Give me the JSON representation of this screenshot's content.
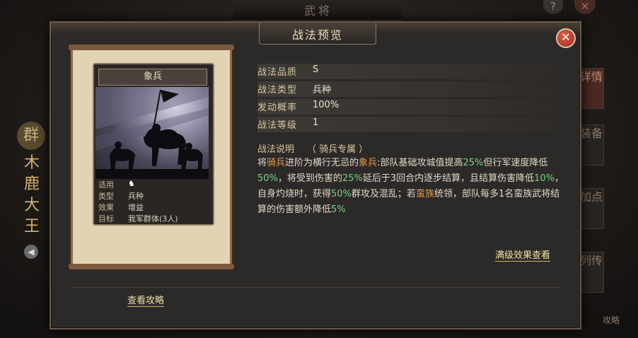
{
  "background": {
    "title": "武将",
    "help": "?",
    "close": "✕",
    "emblem": "群",
    "hero_name": "木鹿大王",
    "tabs": [
      "详情",
      "装备",
      "加点",
      "列传"
    ],
    "attack_text": "攻略"
  },
  "dialog": {
    "title": "战法预览",
    "close_glyph": "✕"
  },
  "card": {
    "name": "象兵",
    "rows": [
      {
        "label": "适用",
        "value": ""
      },
      {
        "label": "类型",
        "value": "兵种"
      },
      {
        "label": "效果",
        "value": "增益"
      },
      {
        "label": "目标",
        "value": "我军群体(3人)"
      }
    ],
    "applies_icon": "horse-icon"
  },
  "attributes": [
    {
      "label": "战法品质",
      "value": "S"
    },
    {
      "label": "战法类型",
      "value": "兵种"
    },
    {
      "label": "发动概率",
      "value": "100%"
    },
    {
      "label": "战法等级",
      "value": "1"
    }
  ],
  "description": {
    "heading": "战法说明",
    "tag": "（ 骑兵专属 ）",
    "segments": [
      {
        "text": "将",
        "style": ""
      },
      {
        "text": "骑兵",
        "style": "orange"
      },
      {
        "text": "进阶为横行无忌的",
        "style": ""
      },
      {
        "text": "象兵",
        "style": "orange"
      },
      {
        "text": ":部队基础攻城值提高",
        "style": ""
      },
      {
        "text": "25%",
        "style": "green"
      },
      {
        "text": "但行军速度降低",
        "style": ""
      },
      {
        "text": "50%",
        "style": "green"
      },
      {
        "text": "，将受到伤害的",
        "style": ""
      },
      {
        "text": "25%",
        "style": "green"
      },
      {
        "text": "延后于3回合内逐步结算，且结算伤害降低",
        "style": ""
      },
      {
        "text": "10%",
        "style": "green"
      },
      {
        "text": "，自身灼烧时，获得",
        "style": ""
      },
      {
        "text": "50%",
        "style": "green"
      },
      {
        "text": "群攻及混乱；若",
        "style": ""
      },
      {
        "text": "蛮族",
        "style": "orange"
      },
      {
        "text": "统领，部队每多1名蛮族武将结算的伤害额外降低",
        "style": ""
      },
      {
        "text": "5%",
        "style": "green"
      }
    ]
  },
  "links": {
    "full_effect": "满级效果查看",
    "guide": "查看攻略"
  },
  "colors": {
    "highlight_orange": "#e89a4a",
    "highlight_green": "#7ad08a",
    "label_gold": "#d8c8a0",
    "link_gold": "#f0e0a8"
  }
}
